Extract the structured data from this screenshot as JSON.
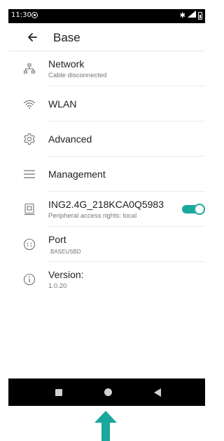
{
  "status_bar": {
    "time": "11:30",
    "icons": [
      "sim-icon",
      "bluetooth-icon",
      "signal-icon",
      "battery-icon"
    ]
  },
  "app_bar": {
    "title": "Base",
    "back_icon": "arrow-left-icon"
  },
  "items": [
    {
      "label": "Network",
      "sub": "Cable disconnected",
      "icon": "network-icon"
    },
    {
      "label": "WLAN",
      "icon": "wifi-icon"
    },
    {
      "label": "Advanced",
      "icon": "gear-icon"
    },
    {
      "label": "Management",
      "icon": "menu-icon"
    },
    {
      "label": "ING2.4G_218KCA0Q5983",
      "sub": "Peripheral access rights: local",
      "icon": "device-icon",
      "toggle_on": true
    },
    {
      "label": "Port",
      "sub": "BASEUSBD",
      "icon": "port-icon"
    },
    {
      "label": "Version:",
      "sub": "1.0.20",
      "icon": "info-icon"
    }
  ],
  "colors": {
    "accent": "#1aa79c",
    "pointer_arrow": "#1aa79c",
    "status_bar": "#000000",
    "nav_bar": "#000000"
  },
  "nav_bar": {
    "icons": [
      "recent-apps-icon",
      "home-icon",
      "back-icon"
    ]
  }
}
